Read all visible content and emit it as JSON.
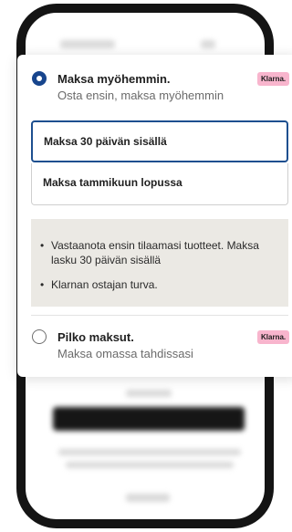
{
  "options": [
    {
      "title": "Maksa myöhemmin.",
      "subtitle": "Osta ensin, maksa myöhemmin",
      "selected": true,
      "badge": "Klarna.",
      "suboptions": [
        {
          "label": "Maksa 30 päivän sisällä",
          "selected": true
        },
        {
          "label": "Maksa tammikuun lopussa",
          "selected": false
        }
      ],
      "info_items": [
        "Vastaanota ensin tilaamasi tuotteet. Maksa lasku 30 päivän sisällä",
        "Klarnan ostajan turva."
      ]
    },
    {
      "title": "Pilko maksut.",
      "subtitle": "Maksa omassa tahdissasi",
      "selected": false,
      "badge": "Klarna."
    }
  ],
  "bullet": "•",
  "colors": {
    "accent": "#17458d",
    "badge_bg": "#f8b5cd",
    "info_bg": "#ebe9e4",
    "phone_frame": "#141414"
  }
}
